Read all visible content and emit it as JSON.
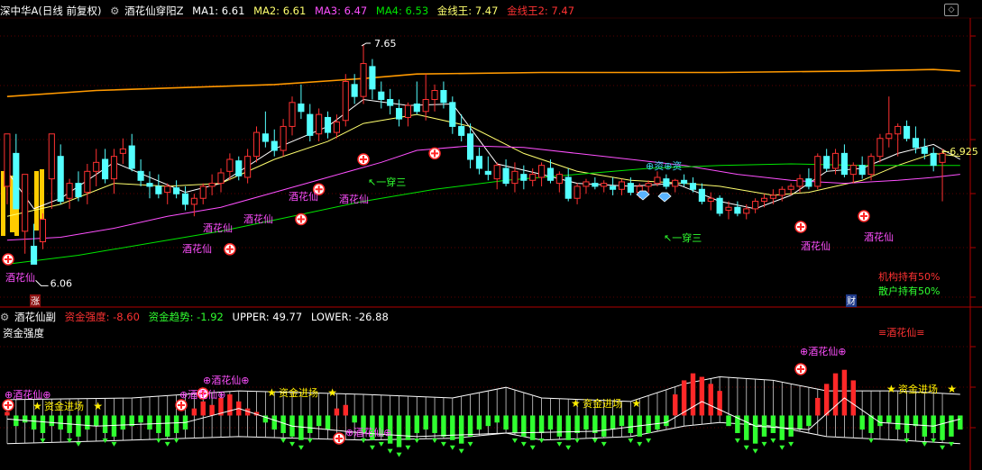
{
  "main_header": {
    "stock_name": "深中华A(日线 前复权)",
    "indicator_name": "酒花仙穿阳Z",
    "ma1": "MA1: 6.61",
    "ma2": "MA2: 6.61",
    "ma3": "MA3: 6.47",
    "ma4": "MA4: 6.53",
    "gold_line": "金线王: 7.47",
    "gold_line2": "金线王2: 7.47"
  },
  "sub_header": {
    "indicator_name": "酒花仙副",
    "strength": "资金强度: -8.60",
    "trend": "资金趋势: -1.92",
    "upper": "UPPER: 49.77",
    "lower": "LOWER: -26.88",
    "panel_title": "资金强度"
  },
  "chart_labels": {
    "high_price": "7.65",
    "low_price": "6.06",
    "last_price": "6.925",
    "buy_signal": "酒花仙",
    "fund_signal": "⊕资⊕资",
    "break_one_three": "一穿三",
    "inst_hold": "机构持有50%",
    "retail_hold": "散户持有50%",
    "zhang": "涨",
    "cai": "财",
    "sub_signal": "≡酒花仙≡",
    "sub_flower": "⊕酒花仙⊕",
    "fund_enter": "资金进场"
  },
  "colors": {
    "up": "#ff3232",
    "down": "#54ffff",
    "ma1": "#ffffff",
    "ma2": "#ffff6e",
    "ma3": "#ff50ff",
    "ma4": "#00e400",
    "gold": "#ff9900",
    "signal": "#ff50ff",
    "green_bar": "#30ff30",
    "red_bar": "#ff2828"
  },
  "chart_data": {
    "type": "candlestick",
    "price_range": [
      5.9,
      7.8
    ],
    "candles": [
      [
        6.7,
        7.05,
        6.58,
        7.05
      ],
      [
        6.92,
        7.05,
        6.55,
        6.55
      ],
      [
        6.4,
        6.78,
        6.25,
        6.78
      ],
      [
        6.3,
        6.45,
        6.18,
        6.18
      ],
      [
        6.33,
        6.52,
        6.28,
        6.48
      ],
      [
        6.75,
        7.05,
        6.55,
        7.05
      ],
      [
        6.9,
        6.98,
        6.58,
        6.6
      ],
      [
        6.62,
        6.75,
        6.55,
        6.72
      ],
      [
        6.72,
        6.8,
        6.6,
        6.63
      ],
      [
        6.66,
        6.85,
        6.58,
        6.8
      ],
      [
        6.8,
        6.95,
        6.7,
        6.86
      ],
      [
        6.88,
        6.95,
        6.72,
        6.75
      ],
      [
        6.75,
        6.95,
        6.65,
        6.9
      ],
      [
        6.92,
        7.02,
        6.85,
        6.95
      ],
      [
        6.97,
        7.05,
        6.8,
        6.82
      ],
      [
        6.8,
        6.88,
        6.7,
        6.74
      ],
      [
        6.72,
        6.8,
        6.62,
        6.7
      ],
      [
        6.7,
        6.78,
        6.62,
        6.65
      ],
      [
        6.66,
        6.72,
        6.58,
        6.7
      ],
      [
        6.69,
        6.74,
        6.62,
        6.65
      ],
      [
        6.65,
        6.7,
        6.54,
        6.58
      ],
      [
        6.58,
        6.65,
        6.5,
        6.62
      ],
      [
        6.62,
        6.72,
        6.58,
        6.7
      ],
      [
        6.7,
        6.78,
        6.64,
        6.72
      ],
      [
        6.72,
        6.82,
        6.66,
        6.79
      ],
      [
        6.8,
        6.92,
        6.74,
        6.88
      ],
      [
        6.87,
        6.9,
        6.74,
        6.77
      ],
      [
        6.76,
        6.95,
        6.72,
        6.9
      ],
      [
        6.9,
        7.1,
        6.86,
        7.06
      ],
      [
        7.05,
        7.2,
        6.96,
        7.0
      ],
      [
        7.0,
        7.08,
        6.9,
        6.94
      ],
      [
        6.94,
        7.15,
        6.9,
        7.1
      ],
      [
        7.1,
        7.3,
        7.04,
        7.26
      ],
      [
        7.25,
        7.38,
        7.15,
        7.2
      ],
      [
        7.18,
        7.25,
        7.0,
        7.04
      ],
      [
        7.05,
        7.22,
        7.0,
        7.18
      ],
      [
        7.16,
        7.2,
        7.02,
        7.06
      ],
      [
        7.06,
        7.18,
        7.02,
        7.13
      ],
      [
        7.14,
        7.45,
        7.1,
        7.4
      ],
      [
        7.38,
        7.45,
        7.25,
        7.3
      ],
      [
        7.3,
        7.65,
        7.25,
        7.52
      ],
      [
        7.5,
        7.55,
        7.28,
        7.35
      ],
      [
        7.33,
        7.4,
        7.22,
        7.28
      ],
      [
        7.28,
        7.35,
        7.18,
        7.24
      ],
      [
        7.22,
        7.28,
        7.1,
        7.15
      ],
      [
        7.16,
        7.26,
        7.1,
        7.24
      ],
      [
        7.25,
        7.4,
        7.18,
        7.2
      ],
      [
        7.2,
        7.45,
        7.14,
        7.28
      ],
      [
        7.28,
        7.38,
        7.2,
        7.34
      ],
      [
        7.34,
        7.4,
        7.22,
        7.26
      ],
      [
        7.26,
        7.3,
        7.05,
        7.1
      ],
      [
        7.1,
        7.18,
        7.0,
        7.04
      ],
      [
        7.05,
        7.12,
        6.82,
        6.88
      ],
      [
        6.9,
        6.96,
        6.78,
        6.82
      ],
      [
        6.8,
        6.9,
        6.74,
        6.78
      ],
      [
        6.75,
        6.86,
        6.68,
        6.84
      ],
      [
        6.82,
        6.88,
        6.7,
        6.72
      ],
      [
        6.72,
        6.86,
        6.66,
        6.8
      ],
      [
        6.78,
        6.84,
        6.68,
        6.74
      ],
      [
        6.74,
        6.82,
        6.7,
        6.78
      ],
      [
        6.76,
        6.86,
        6.7,
        6.84
      ],
      [
        6.82,
        6.88,
        6.72,
        6.74
      ],
      [
        6.72,
        6.8,
        6.66,
        6.78
      ],
      [
        6.76,
        6.82,
        6.6,
        6.62
      ],
      [
        6.62,
        6.72,
        6.58,
        6.7
      ],
      [
        6.7,
        6.75,
        6.65,
        6.73
      ],
      [
        6.72,
        6.76,
        6.68,
        6.7
      ],
      [
        6.7,
        6.74,
        6.66,
        6.72
      ],
      [
        6.7,
        6.76,
        6.64,
        6.68
      ],
      [
        6.68,
        6.75,
        6.64,
        6.73
      ],
      [
        6.72,
        6.76,
        6.64,
        6.66
      ],
      [
        6.66,
        6.72,
        6.62,
        6.7
      ],
      [
        6.7,
        6.74,
        6.66,
        6.72
      ],
      [
        6.72,
        6.8,
        6.7,
        6.76
      ],
      [
        6.75,
        6.78,
        6.68,
        6.7
      ],
      [
        6.7,
        6.75,
        6.66,
        6.74
      ],
      [
        6.74,
        6.78,
        6.7,
        6.72
      ],
      [
        6.72,
        6.76,
        6.66,
        6.68
      ],
      [
        6.68,
        6.72,
        6.58,
        6.6
      ],
      [
        6.6,
        6.66,
        6.54,
        6.62
      ],
      [
        6.62,
        6.64,
        6.5,
        6.52
      ],
      [
        6.54,
        6.6,
        6.48,
        6.56
      ],
      [
        6.56,
        6.6,
        6.5,
        6.52
      ],
      [
        6.52,
        6.58,
        6.48,
        6.55
      ],
      [
        6.55,
        6.62,
        6.52,
        6.6
      ],
      [
        6.6,
        6.65,
        6.56,
        6.62
      ],
      [
        6.62,
        6.68,
        6.58,
        6.64
      ],
      [
        6.64,
        6.7,
        6.6,
        6.68
      ],
      [
        6.68,
        6.72,
        6.64,
        6.7
      ],
      [
        6.7,
        6.78,
        6.66,
        6.75
      ],
      [
        6.75,
        6.82,
        6.68,
        6.7
      ],
      [
        6.7,
        6.92,
        6.68,
        6.9
      ],
      [
        6.9,
        6.95,
        6.8,
        6.82
      ],
      [
        6.82,
        6.95,
        6.78,
        6.92
      ],
      [
        6.92,
        6.98,
        6.76,
        6.78
      ],
      [
        6.78,
        6.86,
        6.72,
        6.84
      ],
      [
        6.84,
        6.9,
        6.75,
        6.78
      ],
      [
        6.78,
        6.92,
        6.74,
        6.9
      ],
      [
        6.9,
        7.05,
        6.86,
        7.02
      ],
      [
        7.02,
        7.3,
        6.96,
        7.05
      ],
      [
        7.05,
        7.12,
        6.9,
        7.1
      ],
      [
        7.1,
        7.14,
        7.0,
        7.02
      ],
      [
        7.02,
        7.1,
        6.92,
        6.96
      ],
      [
        6.96,
        7.02,
        6.88,
        6.92
      ],
      [
        6.92,
        6.96,
        6.8,
        6.84
      ],
      [
        6.86,
        6.95,
        6.6,
        6.92
      ]
    ],
    "moving_averages": [
      {
        "name": "MA1",
        "points": [
          [
            0,
            6.8
          ],
          [
            3,
            6.55
          ],
          [
            6,
            6.62
          ],
          [
            12,
            6.86
          ],
          [
            20,
            6.66
          ],
          [
            24,
            6.72
          ],
          [
            30,
            6.95
          ],
          [
            36,
            7.1
          ],
          [
            40,
            7.28
          ],
          [
            45,
            7.24
          ],
          [
            50,
            7.25
          ],
          [
            55,
            6.85
          ],
          [
            60,
            6.78
          ],
          [
            64,
            6.72
          ],
          [
            70,
            6.7
          ],
          [
            75,
            6.72
          ],
          [
            80,
            6.6
          ],
          [
            84,
            6.55
          ],
          [
            88,
            6.64
          ],
          [
            92,
            6.8
          ],
          [
            96,
            6.82
          ],
          [
            100,
            6.92
          ],
          [
            104,
            6.98
          ],
          [
            107,
            6.88
          ]
        ]
      },
      {
        "name": "MA2",
        "points": [
          [
            0,
            6.5
          ],
          [
            6,
            6.58
          ],
          [
            12,
            6.72
          ],
          [
            18,
            6.7
          ],
          [
            24,
            6.72
          ],
          [
            30,
            6.88
          ],
          [
            36,
            7.0
          ],
          [
            40,
            7.12
          ],
          [
            46,
            7.18
          ],
          [
            52,
            7.1
          ],
          [
            58,
            6.92
          ],
          [
            64,
            6.8
          ],
          [
            70,
            6.74
          ],
          [
            76,
            6.72
          ],
          [
            80,
            6.7
          ],
          [
            86,
            6.64
          ],
          [
            90,
            6.66
          ],
          [
            96,
            6.74
          ],
          [
            100,
            6.84
          ],
          [
            104,
            6.92
          ],
          [
            107,
            6.9
          ]
        ]
      },
      {
        "name": "MA3",
        "points": [
          [
            0,
            6.34
          ],
          [
            6,
            6.36
          ],
          [
            12,
            6.42
          ],
          [
            18,
            6.5
          ],
          [
            24,
            6.56
          ],
          [
            30,
            6.66
          ],
          [
            36,
            6.76
          ],
          [
            42,
            6.86
          ],
          [
            46,
            6.94
          ],
          [
            52,
            6.97
          ],
          [
            58,
            6.96
          ],
          [
            64,
            6.92
          ],
          [
            70,
            6.88
          ],
          [
            76,
            6.84
          ],
          [
            82,
            6.78
          ],
          [
            88,
            6.74
          ],
          [
            94,
            6.72
          ],
          [
            100,
            6.74
          ],
          [
            104,
            6.76
          ],
          [
            107,
            6.78
          ]
        ]
      },
      {
        "name": "MA4",
        "points": [
          [
            0,
            6.18
          ],
          [
            8,
            6.24
          ],
          [
            16,
            6.32
          ],
          [
            24,
            6.4
          ],
          [
            32,
            6.5
          ],
          [
            40,
            6.6
          ],
          [
            48,
            6.68
          ],
          [
            56,
            6.74
          ],
          [
            64,
            6.78
          ],
          [
            72,
            6.82
          ],
          [
            80,
            6.84
          ],
          [
            88,
            6.85
          ],
          [
            96,
            6.84
          ],
          [
            104,
            6.84
          ],
          [
            107,
            6.84
          ]
        ]
      },
      {
        "name": "金线王",
        "points": [
          [
            0,
            7.3
          ],
          [
            10,
            7.34
          ],
          [
            20,
            7.36
          ],
          [
            30,
            7.38
          ],
          [
            40,
            7.42
          ],
          [
            46,
            7.45
          ],
          [
            60,
            7.46
          ],
          [
            80,
            7.46
          ],
          [
            95,
            7.47
          ],
          [
            104,
            7.48
          ],
          [
            107,
            7.47
          ]
        ]
      }
    ],
    "sub_panel": {
      "range": [
        -30,
        52
      ],
      "band_upper": [
        [
          0,
          9
        ],
        [
          14,
          10
        ],
        [
          26,
          14
        ],
        [
          40,
          12
        ],
        [
          50,
          10
        ],
        [
          56,
          16
        ],
        [
          60,
          10
        ],
        [
          70,
          8
        ],
        [
          76,
          18
        ],
        [
          80,
          22
        ],
        [
          86,
          20
        ],
        [
          92,
          14
        ],
        [
          100,
          14
        ],
        [
          107,
          12
        ]
      ],
      "band_lower": [
        [
          0,
          -16
        ],
        [
          14,
          -14
        ],
        [
          26,
          -12
        ],
        [
          40,
          -14
        ],
        [
          50,
          -13
        ],
        [
          56,
          -10
        ],
        [
          60,
          -14
        ],
        [
          70,
          -12
        ],
        [
          76,
          -6
        ],
        [
          80,
          -4
        ],
        [
          86,
          -6
        ],
        [
          92,
          -12
        ],
        [
          100,
          -14
        ],
        [
          107,
          -16
        ]
      ],
      "strength": [
        2,
        -6,
        -4,
        -8,
        -10,
        -6,
        -8,
        -10,
        -12,
        -8,
        -6,
        -10,
        -12,
        -8,
        -6,
        -4,
        -8,
        -10,
        -12,
        -10,
        -8,
        4,
        8,
        6,
        10,
        12,
        8,
        4,
        2,
        -4,
        -8,
        -10,
        -12,
        -14,
        -10,
        -6,
        -8,
        4,
        6,
        -4,
        -10,
        -14,
        -12,
        -16,
        -18,
        -14,
        -10,
        -8,
        -10,
        -12,
        -14,
        -16,
        -12,
        -8,
        -6,
        -4,
        -8,
        -10,
        -12,
        -14,
        -10,
        -8,
        -12,
        -14,
        -10,
        -8,
        -10,
        -12,
        -8,
        -6,
        -10,
        -12,
        -10,
        -8,
        -6,
        12,
        20,
        24,
        22,
        18,
        14,
        -6,
        -10,
        -14,
        -16,
        -12,
        -10,
        -14,
        -12,
        -8,
        -6,
        10,
        18,
        24,
        26,
        20,
        -8,
        -10,
        -6,
        -4,
        -8,
        -10,
        -6,
        -12,
        -10,
        -14,
        -12,
        -8
      ],
      "trend": [
        [
          0,
          -2
        ],
        [
          10,
          -6
        ],
        [
          20,
          -4
        ],
        [
          26,
          4
        ],
        [
          32,
          -6
        ],
        [
          40,
          -10
        ],
        [
          46,
          -12
        ],
        [
          56,
          -10
        ],
        [
          66,
          -9
        ],
        [
          74,
          -4
        ],
        [
          78,
          8
        ],
        [
          84,
          -6
        ],
        [
          90,
          -8
        ],
        [
          94,
          10
        ],
        [
          98,
          -4
        ],
        [
          104,
          -6
        ],
        [
          107,
          -2
        ]
      ]
    }
  }
}
